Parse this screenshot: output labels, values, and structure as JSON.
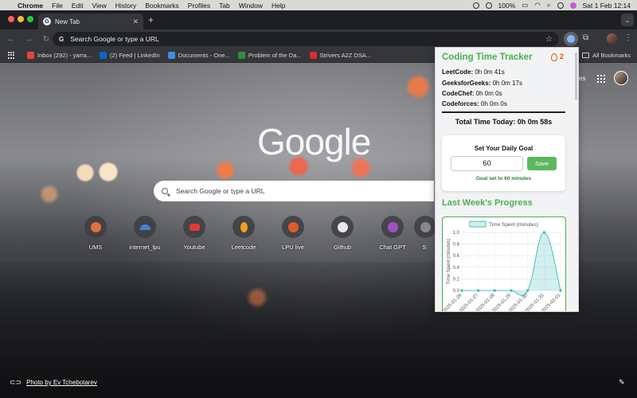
{
  "menubar": {
    "app": "Chrome",
    "items": [
      "File",
      "Edit",
      "View",
      "History",
      "Bookmarks",
      "Profiles",
      "Tab",
      "Window",
      "Help"
    ],
    "battery": "100%",
    "datetime": "Sat 1 Feb  12:14"
  },
  "tab": {
    "title": "New Tab",
    "close": "✕",
    "new": "+"
  },
  "omnibox": {
    "placeholder": "Search Google or type a URL"
  },
  "bookmarks": {
    "items": [
      {
        "label": "Inbox (292) - yarra...",
        "color": "#ea4335"
      },
      {
        "label": "(2) Feed | LinkedIn",
        "color": "#0a66c2"
      },
      {
        "label": "Documents - One...",
        "color": "#3e8ee0"
      },
      {
        "label": "Problem of the Da...",
        "color": "#2f8d46"
      },
      {
        "label": "Strivers A2Z DSA...",
        "color": "#d32f2f"
      }
    ],
    "all": "All Bookmarks"
  },
  "ntp": {
    "logo": "Google",
    "search_placeholder": "Search Google or type a URL",
    "partial_text": "es",
    "shortcuts": [
      {
        "label": "UMS",
        "color": "#e0703a"
      },
      {
        "label": "internet_lpu",
        "color": "#4a7fd4"
      },
      {
        "label": "Youtube",
        "color": "#e53935"
      },
      {
        "label": "Leetcode",
        "color": "#f0a020"
      },
      {
        "label": "LPU live",
        "color": "#e05a2a"
      },
      {
        "label": "Github",
        "color": "#e8e8e8"
      },
      {
        "label": "Chat GPT",
        "color": "#a050c0"
      },
      {
        "label": "S",
        "color": "#888888"
      }
    ],
    "credit": "Photo by Ev Tchebotarev"
  },
  "popup": {
    "title": "Coding Time Tracker",
    "streak": "2",
    "stats": [
      {
        "site": "LeetCode:",
        "time": " 0h 0m 41s"
      },
      {
        "site": "GeeksforGeeks:",
        "time": " 0h 0m 17s"
      },
      {
        "site": "CodeChef:",
        "time": " 0h 0m 0s"
      },
      {
        "site": "Codeforces:",
        "time": " 0h 0m 0s"
      }
    ],
    "total": "Total Time Today: 0h 0m 58s",
    "goal": {
      "title": "Set Your Daily Goal",
      "value": "60",
      "save": "Save",
      "message": "Goal set to 60 minutes"
    },
    "weekly_title": "Last Week's Progress"
  },
  "chart_data": {
    "type": "area",
    "legend": "Time Spent (minutes)",
    "ylabel": "Time Spent (minutes)",
    "x": [
      "2025-01-26",
      "2025-01-27",
      "2025-01-28",
      "2025-01-29",
      "2025-01-30",
      "2025-01-31",
      "2025-02-01"
    ],
    "values": [
      0,
      0,
      0,
      0,
      0,
      1.0,
      0
    ],
    "ylim": [
      0,
      1.0
    ],
    "yticks": [
      0,
      0.2,
      0.4,
      0.6,
      0.8,
      1.0
    ],
    "color": "#4bc0c0"
  }
}
